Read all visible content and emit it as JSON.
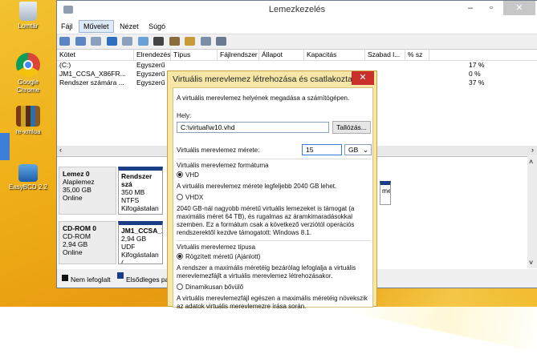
{
  "desktop": {
    "icons": [
      {
        "label": "Lomtár",
        "icon": "recycle-bin-icon"
      },
      {
        "label": "Google Chrome",
        "icon": "chrome-icon"
      },
      {
        "label": "re-xmlua",
        "icon": "books-icon"
      },
      {
        "label": "EasyBCD 2.2",
        "icon": "easybcd-icon"
      }
    ]
  },
  "window": {
    "title": "Lemezkezelés",
    "controls": {
      "minimize": "–",
      "maximize": "▫",
      "close": "✕"
    },
    "menu": [
      "Fájl",
      "Művelet",
      "Nézet",
      "Súgó"
    ],
    "active_menu_index": 1
  },
  "volume_list": {
    "columns": [
      "Kötet",
      "Elrendezés",
      "Típus",
      "Fájlrendszer",
      "Állapot",
      "Kapacitás",
      "Szabad l...",
      "% sz"
    ],
    "rows": [
      [
        "(C:)",
        "Egyszerű",
        "",
        "",
        "",
        "",
        "",
        "17 %"
      ],
      [
        "JM1_CCSA_X86FR...",
        "Egyszerű",
        "",
        "",
        "",
        "",
        "",
        "0 %"
      ],
      [
        "Rendszer számára ...",
        "Egyszerű",
        "",
        "",
        "",
        "",
        "",
        "37 %"
      ]
    ]
  },
  "disks": [
    {
      "name": "Lemez 0",
      "type": "Alaplemez",
      "size": "35,00 GB",
      "status": "Online",
      "part_title": "Rendszer szá",
      "part_line1": "350 MB NTFS",
      "part_line2": "Kifogástalan ("
    },
    {
      "name": "CD-ROM 0",
      "type": "CD-ROM",
      "size": "2,94 GB",
      "status": "Online",
      "part_title": "JM1_CCSA_X",
      "part_line1": "2,94 GB UDF",
      "part_line2": "Kifogástalan ("
    }
  ],
  "right_fragment": "me",
  "legend": [
    {
      "label": "Nem lefoglalt",
      "color": "#111111"
    },
    {
      "label": "Elsődleges pa",
      "color": "#1a3e86"
    }
  ],
  "dialog": {
    "title": "Virtuális merevlemez létrehozása és csatlakoztatása",
    "intro": "A virtuális merevlemez helyének megadása a számítógépen.",
    "location_label": "Hely:",
    "location_value": "C:\\virtual\\w10.vhd",
    "browse_label": "Tallózás...",
    "size_label": "Virtuális merevlemez mérete:",
    "size_value": "15",
    "size_unit": "GB",
    "format_label": "Virtuális merevlemez formátuma",
    "vhd_label": "VHD",
    "vhd_desc": "A virtuális merevlemez mérete legfeljebb 2040 GB lehet.",
    "vhdx_label": "VHDX",
    "vhdx_desc": "2040 GB-nál nagyobb méretű virtuális lemezeket is támogat (a maximális méret 64 TB), és rugalmas az áramkimaradásokkal szemben. Ez a formátum csak a következő verziótól operációs rendszerektől kezdve támogatott: Windows 8.1.",
    "type_label": "Virtuális merevlemez típusa",
    "fixed_label": "Rögzített méretű (Ajánlott)",
    "fixed_desc": "A rendszer a maximális méretéig bezárólag lefoglalja a virtuális merevlemezfájlt a virtuális merevlemez létrehozásakor.",
    "dynamic_label": "Dinamikusan bővülő",
    "dynamic_desc": "A virtuális merevlemezfájl egészen a maximális méretéig növekszik az adatok virtuális merevlemezre írása során.",
    "selected_format": "VHD",
    "selected_type": "fixed"
  }
}
